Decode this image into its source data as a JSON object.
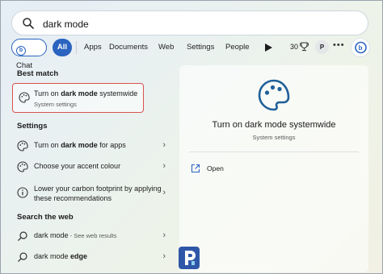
{
  "search": {
    "value": "dark mode"
  },
  "filters": {
    "chat": "Chat",
    "all": "All",
    "apps": "Apps",
    "documents": "Documents",
    "web": "Web",
    "settings": "Settings",
    "people": "People",
    "points": "30",
    "profile_initial": "P",
    "more": "•••"
  },
  "best_match": {
    "heading": "Best match",
    "title_pre": "Turn on ",
    "title_bold": "dark mode",
    "title_post": " systemwide",
    "subtitle": "System settings"
  },
  "settings_section": {
    "heading": "Settings",
    "items": [
      {
        "pre": "Turn on ",
        "bold": "dark mode",
        "post": " for apps"
      },
      {
        "pre": "Choose your accent colour",
        "bold": "",
        "post": ""
      },
      {
        "pre": "Lower your carbon footprint by applying these recommendations",
        "bold": "",
        "post": ""
      }
    ]
  },
  "web_section": {
    "heading": "Search the web",
    "items": [
      {
        "text": "dark mode",
        "suffix": " - See web results"
      },
      {
        "pre": "dark mode ",
        "bold": "edge"
      }
    ]
  },
  "detail": {
    "title": "Turn on dark mode systemwide",
    "subtitle": "System settings",
    "open": "Open"
  },
  "colors": {
    "accent": "#2b64c0",
    "highlight_border": "#d9534f"
  },
  "icons": [
    "search-icon",
    "bing-chat-icon",
    "play-icon",
    "trophy-icon",
    "bing-icon",
    "palette-icon",
    "chevron-right-icon",
    "open-external-icon",
    "site-logo"
  ]
}
